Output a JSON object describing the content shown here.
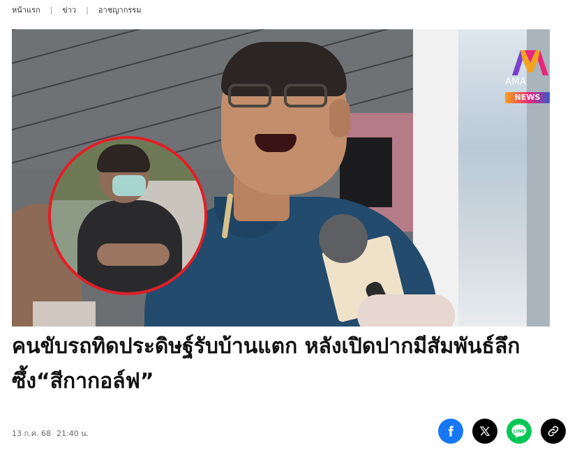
{
  "breadcrumb": {
    "items": [
      {
        "label": "หน้าแรก"
      },
      {
        "label": "ข่าว"
      },
      {
        "label": "อาชญากรรม"
      }
    ],
    "separator": "|"
  },
  "hero": {
    "image_name": "news-photo",
    "logo": {
      "brand": "AMA",
      "badge": "NEWS"
    }
  },
  "article": {
    "headline": "คนขับรถทิดประดิษฐ์รับบ้านแตก หลังเปิดปากมีสัมพันธ์ลึกซึ้ง“สีกากอล์ฟ”",
    "date": "13 ก.ค. 68",
    "time": "21:40 น."
  },
  "share": {
    "buttons": [
      {
        "icon": "facebook-icon",
        "color": "#1877f2"
      },
      {
        "icon": "x-icon",
        "color": "#000000"
      },
      {
        "icon": "line-icon",
        "color": "#06c755",
        "label": "LINE"
      },
      {
        "icon": "link-icon",
        "color": "#000000"
      }
    ]
  },
  "colors": {
    "inset_border": "#e41d25",
    "text": "#111111",
    "muted": "#666666"
  }
}
